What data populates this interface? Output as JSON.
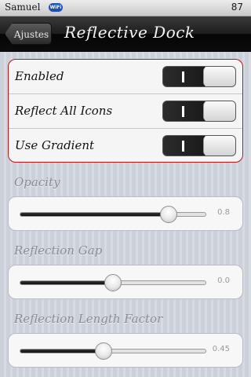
{
  "status_bar": {
    "carrier": "Samuel",
    "wifi_badge": "WiFi",
    "battery": "87"
  },
  "nav": {
    "back_label": "Ajustes",
    "title": "Reflective Dock"
  },
  "toggles": [
    {
      "label": "Enabled",
      "on": true
    },
    {
      "label": "Reflect All Icons",
      "on": true
    },
    {
      "label": "Use Gradient",
      "on": true
    }
  ],
  "sliders": [
    {
      "label": "Opacity",
      "value_text": "0.8",
      "fraction": 0.8
    },
    {
      "label": "Reflection Gap",
      "value_text": "0.0",
      "fraction": 0.5
    },
    {
      "label": "Reflection Length Factor",
      "value_text": "0.45",
      "fraction": 0.45
    }
  ],
  "colors": {
    "group_border": "#c0141c",
    "navbar": "#1d1d1d",
    "background": "#cfd3dc"
  }
}
